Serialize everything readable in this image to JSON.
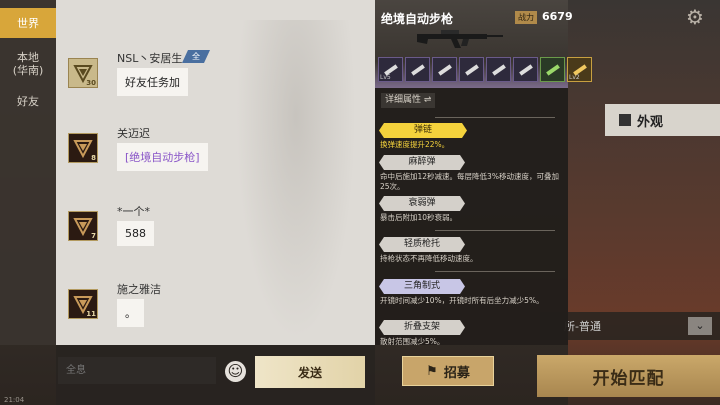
{
  "tabs": [
    {
      "label": "世界",
      "active": true
    },
    {
      "label": "本地\n(华南)",
      "active": false
    },
    {
      "label": "好友",
      "active": false
    }
  ],
  "messages": [
    {
      "name": "NSL丶安居生",
      "badge": "全村希望",
      "level": "30",
      "text": "好友任务加",
      "link": false
    },
    {
      "name": "关迈迟",
      "badge": "",
      "level": "8",
      "text": "[绝境自动步枪]",
      "link": true
    },
    {
      "name": "*一个*",
      "badge": "",
      "level": "7",
      "text": "588",
      "link": false
    },
    {
      "name": "施之雅洁",
      "badge": "",
      "level": "11",
      "text": "。",
      "link": false
    }
  ],
  "input": {
    "placeholder": "全息",
    "send_label": "发送",
    "emoji_icon": "smiley-icon"
  },
  "weapon": {
    "title": "绝境自动步枪",
    "power_label": "战力",
    "power_value": "6679",
    "slot_tags": [
      "Lv5",
      "",
      "",
      "",
      "",
      "",
      "",
      "Lv2"
    ],
    "detail_label": "详细属性 ⇌",
    "perks": [
      {
        "name": "弹链",
        "desc": "换弹速度提升22%。",
        "style": "highlight"
      },
      {
        "name": "麻醉弹",
        "desc": "命中后施加12秒减速。每层降低3%移动速度，可叠加25次。",
        "style": "normal"
      },
      {
        "name": "衰弱弹",
        "desc": "暴击后附加10秒衰弱。",
        "style": "normal"
      },
      {
        "name": "轻质枪托",
        "desc": "持枪状态不再降低移动速度。",
        "style": "normal"
      },
      {
        "name": "三角制式",
        "desc": "开镜时间减少10%，开镜时所有后坐力减少5%。",
        "style": "blue"
      },
      {
        "name": "折叠支架",
        "desc": "散射范围减少5%。",
        "style": "normal"
      }
    ]
  },
  "background": {
    "appearance_label": "外观",
    "mode_label": "所-普通",
    "recruit_label": "招募",
    "start_label": "开始匹配",
    "status_time": "21:04"
  },
  "colors": {
    "accent_gold": "#d8a63a",
    "link_purple": "#8a56c8",
    "highlight_yellow": "#f4d23c"
  }
}
